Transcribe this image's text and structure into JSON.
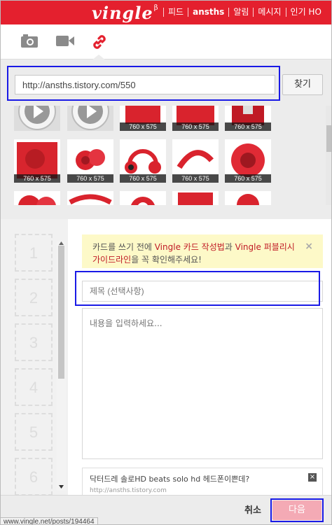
{
  "header": {
    "logo": "vingle",
    "logo_sup": "β",
    "nav": [
      "피드",
      "ansths",
      "알림",
      "메시지",
      "인기 HO"
    ]
  },
  "tabs": {
    "items": [
      {
        "name": "camera-icon"
      },
      {
        "name": "video-icon"
      },
      {
        "name": "link-icon",
        "active": true
      }
    ]
  },
  "url": {
    "value": "http://ansths.tistory.com/550",
    "find_label": "찾기"
  },
  "thumbnails": [
    {
      "caption": ""
    },
    {
      "caption": ""
    },
    {
      "caption": "760 x 575"
    },
    {
      "caption": "760 x 575"
    },
    {
      "caption": "760 x 575"
    },
    {
      "caption": "760 x 575"
    },
    {
      "caption": "760 x 575"
    },
    {
      "caption": "760 x 575"
    },
    {
      "caption": "760 x 575"
    },
    {
      "caption": "760 x 575"
    },
    {
      "caption": ""
    },
    {
      "caption": ""
    },
    {
      "caption": ""
    },
    {
      "caption": ""
    },
    {
      "caption": ""
    }
  ],
  "slots": [
    "1",
    "2",
    "3",
    "4",
    "5",
    "6"
  ],
  "notice": {
    "pre": "카드를 쓰기 전에 ",
    "link1": "Vingle 카드 작성법",
    "mid": "과 ",
    "link2": "Vingle 퍼블리시 가이드라인",
    "post": "을 꼭 확인해주세요!",
    "close": "×"
  },
  "form": {
    "title_placeholder": "제목 (선택사항)",
    "content_placeholder": "내용을 입력하세요..."
  },
  "link_card": {
    "title": "닥터드레 솔로HD beats solo hd 헤드폰이쁜데?",
    "url": "http://ansths.tistory.com",
    "close": "×"
  },
  "footer": {
    "cancel": "취소",
    "next": "다음"
  },
  "status_bar": "www.vingle.net/posts/194464",
  "colors": {
    "brand": "#e4202e",
    "highlight": "#1a1ae6",
    "next_button": "#f4aab5"
  }
}
